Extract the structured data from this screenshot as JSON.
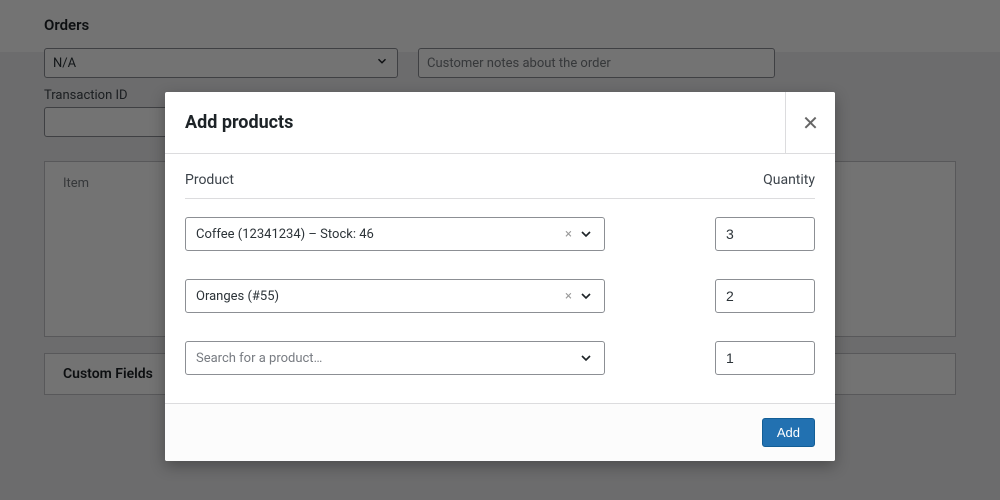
{
  "page": {
    "title": "Orders",
    "payment_select": "N/A",
    "transaction_label": "Transaction ID",
    "notes_placeholder": "Customer notes about the order",
    "item_label": "Item",
    "custom_fields_label": "Custom Fields"
  },
  "modal": {
    "title": "Add products",
    "close_glyph": "✕",
    "product_header": "Product",
    "quantity_header": "Quantity",
    "rows": [
      {
        "label": "Coffee (12341234) – Stock: 46",
        "qty": "3",
        "has_value": true
      },
      {
        "label": "Oranges (#55)",
        "qty": "2",
        "has_value": true
      },
      {
        "label": "Search for a product…",
        "qty": "1",
        "has_value": false
      }
    ],
    "clear_glyph": "×",
    "add_label": "Add"
  }
}
